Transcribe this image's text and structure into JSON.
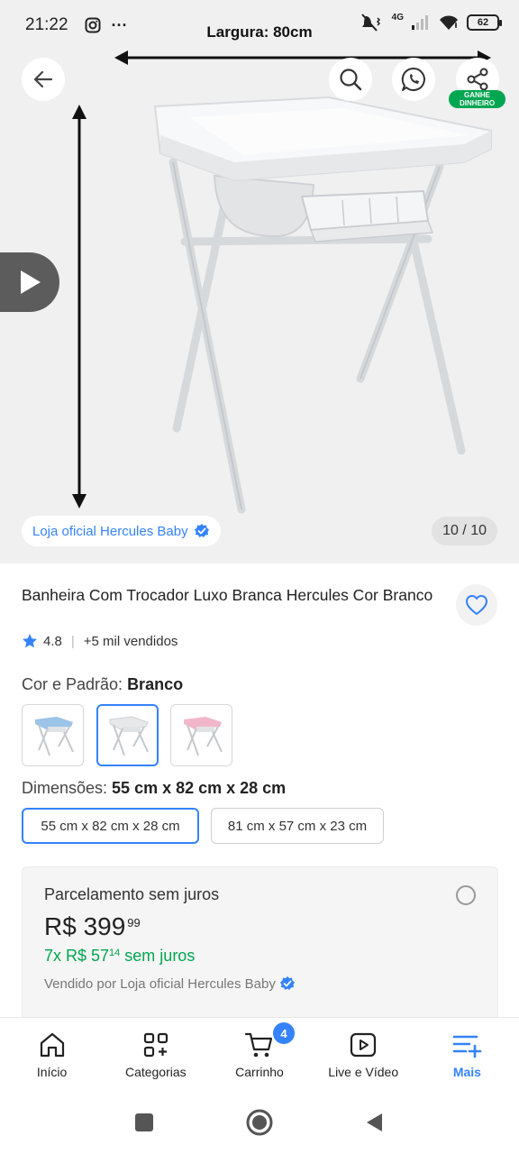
{
  "status_bar": {
    "time": "21:22",
    "more": "···",
    "network": "4G",
    "battery": "62"
  },
  "hero": {
    "dimension_label": "Largura: 80cm",
    "earn_badge_line1": "GANHE",
    "earn_badge_line2": "DINHEIRO",
    "store_pill": "Loja oficial Hercules Baby",
    "image_counter": "10 / 10"
  },
  "product": {
    "title": "Banheira Com Trocador Luxo Branca Hercules Cor Branco",
    "rating": "4.8",
    "sold": "+5 mil vendidos"
  },
  "color_section": {
    "label": "Cor e Padrão: ",
    "value": "Branco",
    "selected_index": 1
  },
  "dimension_section": {
    "label": "Dimensões: ",
    "value": "55 cm x 82 cm x 28 cm",
    "options": [
      "55 cm x 82 cm x 28 cm",
      "81 cm x 57 cm x 23 cm"
    ]
  },
  "payment": {
    "title": "Parcelamento sem juros",
    "price_main": "R$ 399",
    "price_cents": "99",
    "installment_prefix": "7x R$ 57",
    "installment_cents": "14",
    "installment_suffix": " sem juros",
    "seller": "Vendido por Loja oficial Hercules Baby"
  },
  "bottom_nav": {
    "items": [
      {
        "label": "Início",
        "icon": "home-icon"
      },
      {
        "label": "Categorias",
        "icon": "categories-icon"
      },
      {
        "label": "Carrinho",
        "icon": "cart-icon"
      },
      {
        "label": "Live e Vídeo",
        "icon": "play-video-icon"
      },
      {
        "label": "Mais",
        "icon": "menu-plus-icon"
      }
    ],
    "cart_count": "4"
  },
  "colors": {
    "accent": "#3483fa",
    "green": "#00a650"
  }
}
